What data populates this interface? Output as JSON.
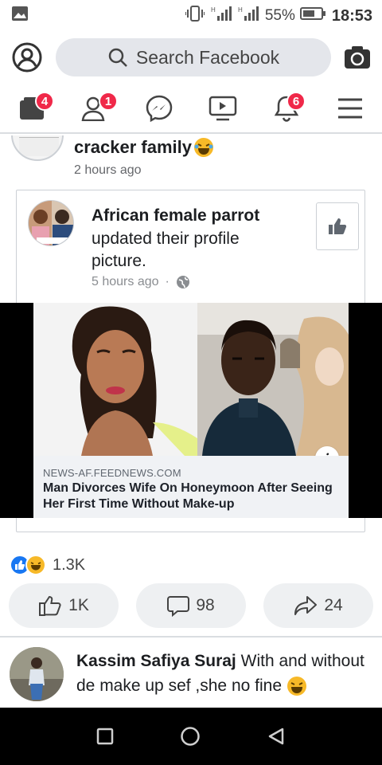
{
  "status_bar": {
    "battery": "55%",
    "time": "18:53"
  },
  "search": {
    "placeholder": "Search Facebook"
  },
  "nav": {
    "badges": {
      "home": "4",
      "friends": "1",
      "notifications": "6"
    }
  },
  "previous_post": {
    "title": "cracker family",
    "time": "2 hours ago"
  },
  "shared_post": {
    "author": "African female parrot",
    "action_text": "updated their profile picture.",
    "time": "5 hours ago",
    "separator": "·",
    "link": {
      "domain": "NEWS-AF.FEEDNEWS.COM",
      "title": "Man Divorces Wife On Honeymoon After Seeing Her First Time Without Make-up",
      "info_label": "i"
    }
  },
  "reactions": {
    "count": "1.3K",
    "types": [
      "like",
      "haha"
    ]
  },
  "actions": {
    "like_count": "1K",
    "comment_count": "98",
    "share_count": "24"
  },
  "comment": {
    "author": "Kassim Safiya Suraj",
    "text": "With and without de make up sef ,she no fine"
  },
  "colors": {
    "badge": "#f02849",
    "link_bg": "#f0f2f5",
    "button_bg": "#eef0f2",
    "like_blue": "#1877f2",
    "haha_yellow": "#f7b928"
  }
}
